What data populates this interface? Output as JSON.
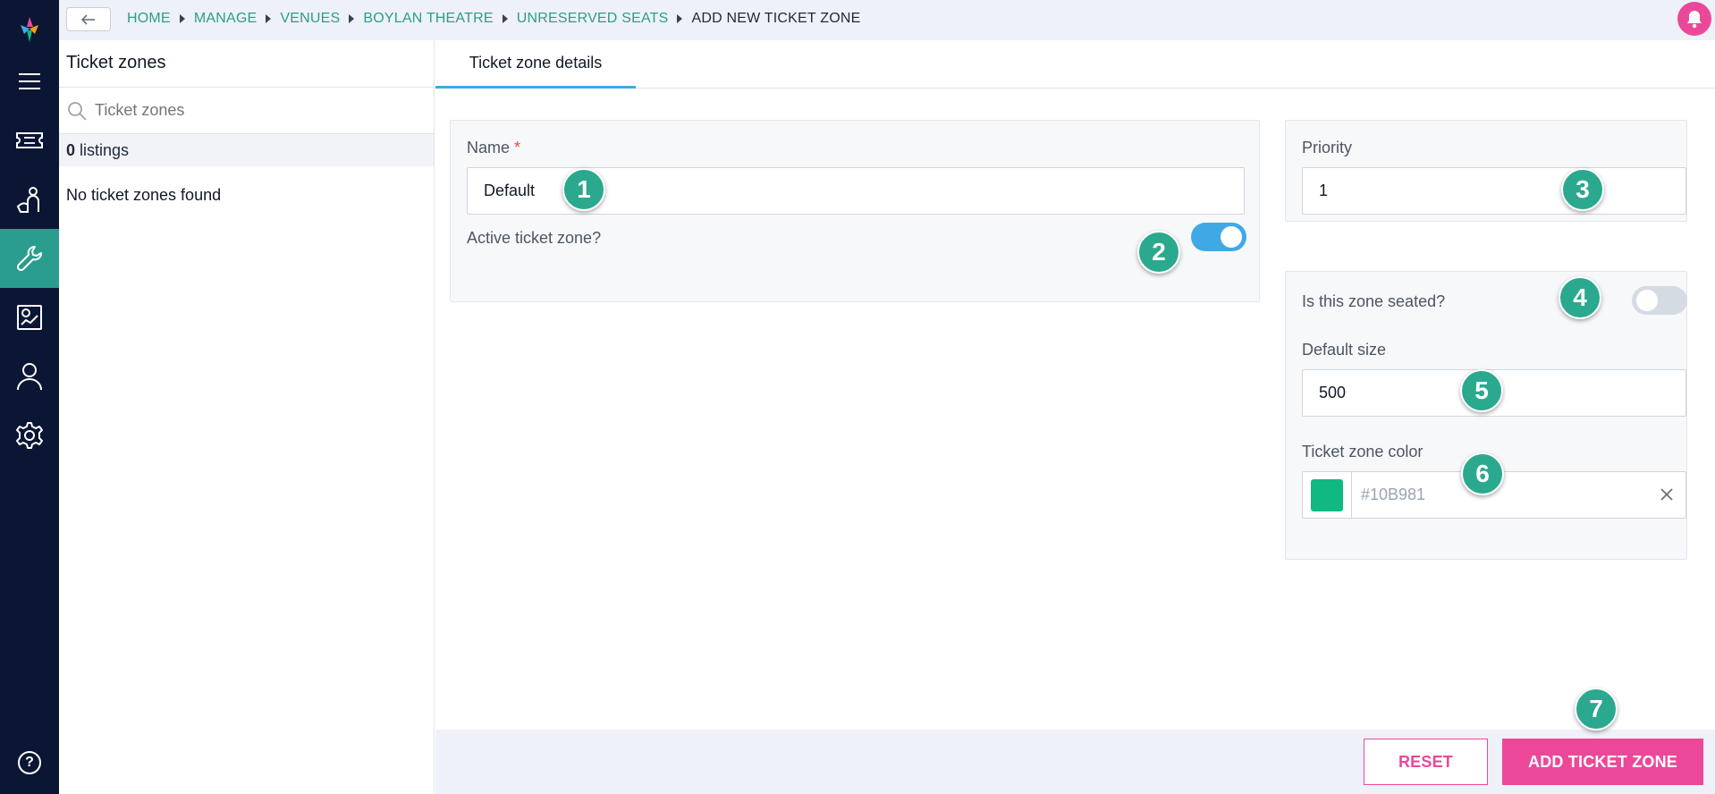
{
  "breadcrumb": {
    "items": [
      "HOME",
      "MANAGE",
      "VENUES",
      "BOYLAN THEATRE",
      "UNRESERVED SEATS"
    ],
    "current": "ADD NEW TICKET ZONE"
  },
  "nav": {
    "icons": [
      "logo-icon",
      "menu-icon",
      "ticket-icon",
      "users-icon",
      "wrench-icon",
      "reports-icon",
      "person-icon",
      "gear-icon",
      "help-icon"
    ],
    "active": "wrench-icon",
    "help_label": "?"
  },
  "sidebar": {
    "title": "Ticket zones",
    "search_placeholder": "Ticket zones",
    "count": "0",
    "count_label": "listings",
    "empty_message": "No ticket zones found"
  },
  "main": {
    "tab": "Ticket zone details",
    "name_label": "Name",
    "required_mark": "*",
    "name_value": "Default",
    "active_label": "Active ticket zone?",
    "active_on": true,
    "priority_label": "Priority",
    "priority_value": "1",
    "seated_label": "Is this zone seated?",
    "seated_on": false,
    "default_size_label": "Default size",
    "default_size_value": "500",
    "color_label": "Ticket zone color",
    "color_value": "#10B981"
  },
  "annotations": [
    "1",
    "2",
    "3",
    "4",
    "5",
    "6",
    "7"
  ],
  "footer": {
    "reset_label": "RESET",
    "add_label": "ADD TICKET ZONE"
  },
  "colors": {
    "rail": "#0b1634",
    "accent": "#2a9d8f",
    "toggle_on": "#3fa9e6",
    "primary_button": "#ec4899",
    "swatch": "#10B981"
  }
}
